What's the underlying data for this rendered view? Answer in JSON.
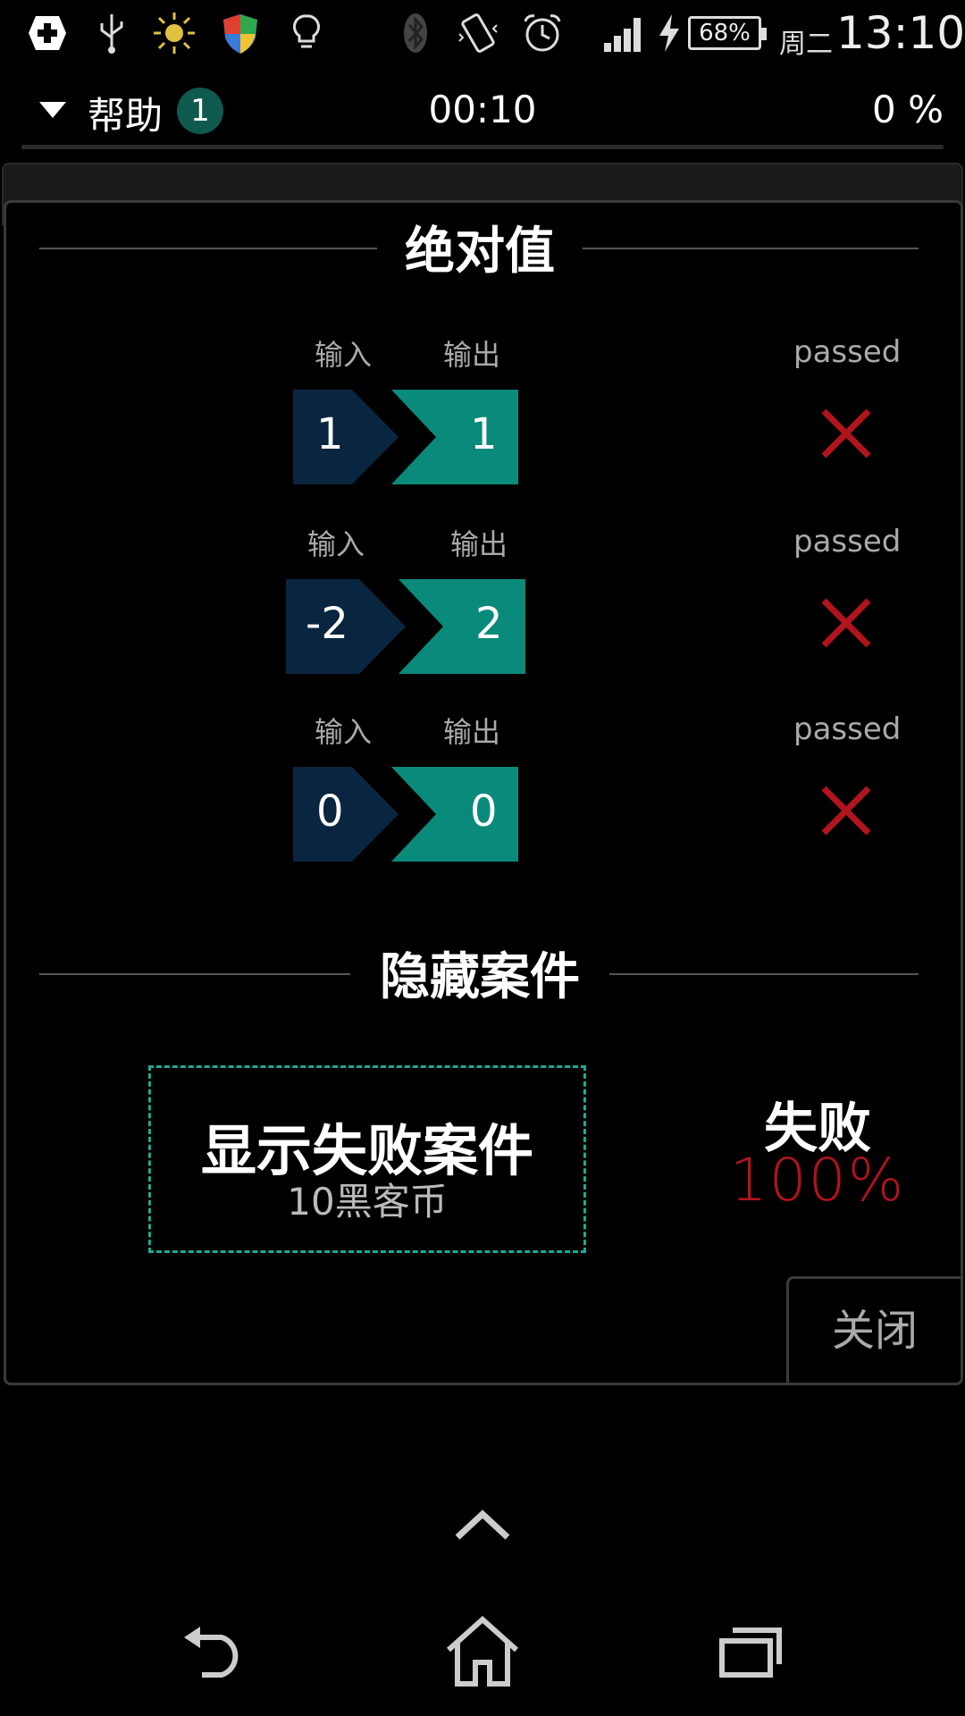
{
  "status_bar": {
    "battery": "68%",
    "weekday": "周二",
    "time": "13:10",
    "icons": [
      "medical-cross-icon",
      "usb-icon",
      "sun-icon",
      "shield-icon",
      "lightbulb-icon",
      "bluetooth-icon",
      "vibrate-icon",
      "alarm-clock-icon",
      "signal-bars-icon",
      "charging-bolt-icon"
    ]
  },
  "topbar": {
    "help_label": "帮助",
    "help_count": "1",
    "timer": "00:10",
    "percent": "0 %"
  },
  "panel": {
    "section_title": "绝对值",
    "rows": [
      {
        "in_label": "输入",
        "out_label": "输出",
        "input": "1",
        "output": "1",
        "status": "passed"
      },
      {
        "in_label": "输入",
        "out_label": "输出",
        "input": "-2",
        "output": "2",
        "status": "passed"
      },
      {
        "in_label": "输入",
        "out_label": "输出",
        "input": "0",
        "output": "0",
        "status": "passed"
      }
    ],
    "hidden_title": "隐藏案件",
    "show_fail_title": "显示失败案件",
    "show_fail_cost": "10黑客币",
    "fail_label": "失败",
    "fail_percent": "100%",
    "close_label": "关闭"
  },
  "colors": {
    "input_bg": "#0a2540",
    "output_bg": "#0a8a7a",
    "fail_red": "#b0141c",
    "dashed_teal": "#1ea897",
    "badge_bg": "#0e5a4e"
  }
}
